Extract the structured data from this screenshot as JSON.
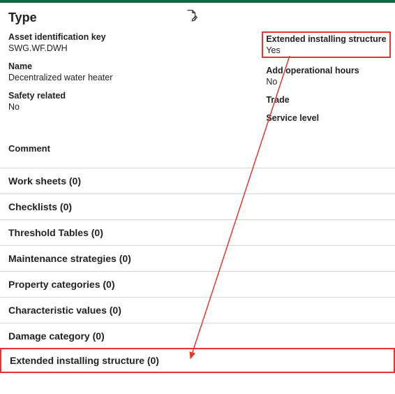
{
  "header": {
    "title": "Type"
  },
  "fields": {
    "asset_id_label": "Asset identification key",
    "asset_id_value": "SWG.WF.DWH",
    "name_label": "Name",
    "name_value": "Decentralized water heater",
    "safety_label": "Safety related",
    "safety_value": "No",
    "extinst_label": "Extended installing structure",
    "extinst_value": "Yes",
    "addhours_label": "Add operational hours",
    "addhours_value": "No",
    "trade_label": "Trade",
    "trade_value": "",
    "service_label": "Service level",
    "service_value": ""
  },
  "comment_label": "Comment",
  "sections": {
    "worksheets": "Work sheets (0)",
    "checklists": "Checklists (0)",
    "threshold": "Threshold Tables (0)",
    "maintenance": "Maintenance strategies (0)",
    "propcats": "Property categories (0)",
    "charvals": "Characteristic values (0)",
    "damage": "Damage category (0)",
    "extinst": "Extended installing structure (0)"
  }
}
